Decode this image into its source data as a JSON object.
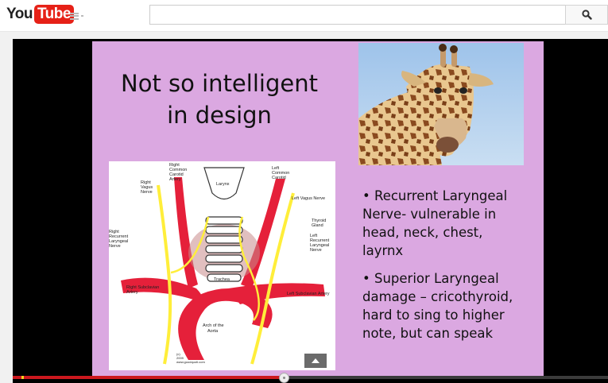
{
  "header": {
    "logo": {
      "you": "You",
      "tube": "Tube"
    },
    "search": {
      "placeholder": "",
      "value": ""
    },
    "icons": {
      "guide": "menu-icon",
      "search": "search-icon"
    }
  },
  "slide": {
    "title": "Not so intelligent\nin design",
    "image_alt": "giraffe",
    "diagram": {
      "labels": {
        "right_common_carotid": "Right\nCommon\nCarotid\nArtery",
        "left_common_carotid": "Left\nCommon\nCarotid",
        "right_vagus": "Right\nVagus\nNerve",
        "larynx": "Larynx",
        "left_vagus": "Left Vagus Nerve",
        "thyroid": "Thyroid\nGland",
        "right_recurrent": "Right\nRecurrent\nLaryngeal\nNerve",
        "left_recurrent": "Left\nRecurrent\nLaryngeal\nNerve",
        "trachea": "Trachea",
        "right_subclavian": "Right Subclavian\nArtery",
        "left_subclavian": "Left Subclavian Artery",
        "arch": "Arch of the\nAorta",
        "credit": "(c)\n2009\nwww.goodquoti.com"
      }
    },
    "bullets": [
      "• Recurrent Laryngeal\nNerve- vulnerable in\nhead, neck, chest,\nlayrnx",
      "• Superior Laryngeal\ndamage – cricothyroid,\nhard to sing to higher\nnote, but can speak"
    ]
  },
  "player": {
    "progress": 0.455,
    "colors": {
      "played": "#cc181e",
      "slide_bg": "#dba8e1"
    },
    "icons": {
      "popup": "caret-up-icon"
    }
  }
}
